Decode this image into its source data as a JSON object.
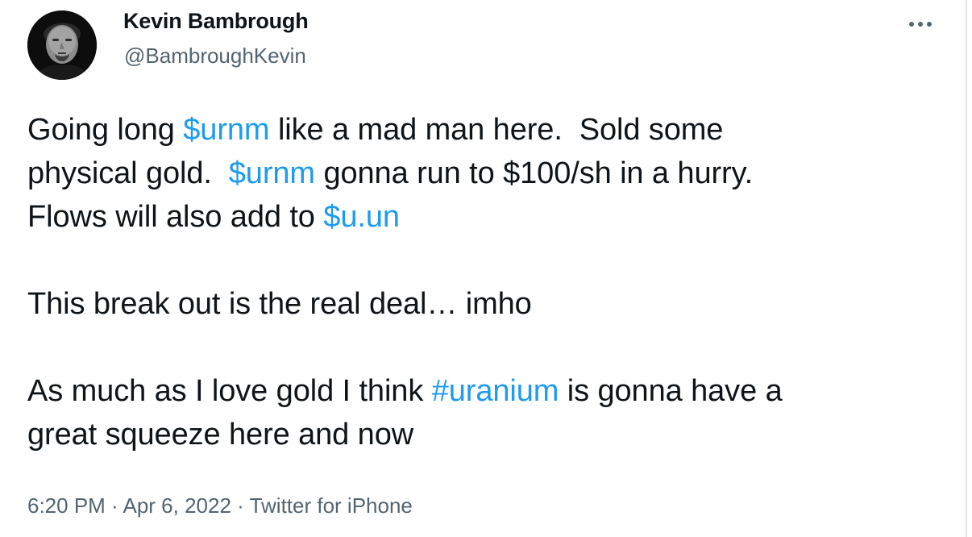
{
  "author": {
    "name": "Kevin Bambrough",
    "handle": "@BambroughKevin"
  },
  "tweet": {
    "line1": {
      "a": "Going long ",
      "cashtag1": "$urnm",
      "b": " like a mad man here.  Sold some"
    },
    "line2": {
      "a": "physical gold.  ",
      "cashtag2": "$urnm",
      "b": " gonna run to $100/sh in a hurry."
    },
    "line3": {
      "a": "Flows will also add to ",
      "cashtag3": "$u.un"
    },
    "line4": "This break out is the real deal… imho",
    "line5": {
      "a": "As much as I love gold I think ",
      "hashtag": "#uranium",
      "b": " is gonna have a"
    },
    "line6": "great squeeze here and now"
  },
  "meta": {
    "time": "6:20 PM",
    "sep1": " · ",
    "date": "Apr 6, 2022",
    "sep2": " · ",
    "source": "Twitter for iPhone"
  },
  "colors": {
    "link": "#1d9bf0",
    "secondary": "#536471",
    "text": "#0f1419"
  },
  "icons": {
    "more": "more-horizontal-icon"
  }
}
